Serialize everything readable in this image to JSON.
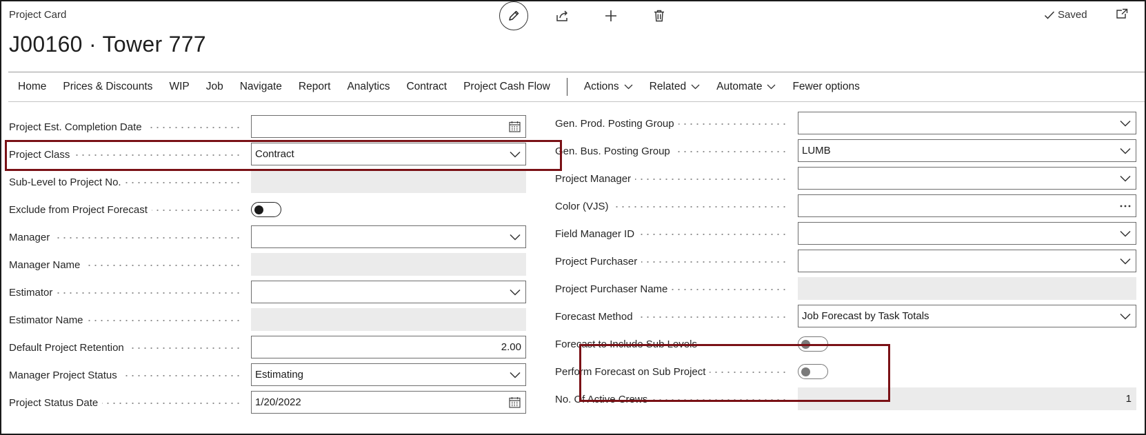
{
  "header": {
    "caption": "Project Card",
    "title": "J00160 · Tower 777",
    "saved_label": "Saved"
  },
  "toolbar": {
    "icons": [
      "edit-icon",
      "share-icon",
      "add-icon",
      "delete-icon",
      "popout-icon"
    ]
  },
  "menu": {
    "items": [
      "Home",
      "Prices & Discounts",
      "WIP",
      "Job",
      "Navigate",
      "Report",
      "Analytics",
      "Contract",
      "Project Cash Flow"
    ],
    "dropdowns": [
      "Actions",
      "Related",
      "Automate"
    ],
    "fewer_options": "Fewer options"
  },
  "left_fields": [
    {
      "label": "Project Est. Completion Date",
      "value": "",
      "type": "date"
    },
    {
      "label": "Project Class",
      "value": "Contract",
      "type": "select"
    },
    {
      "label": "Sub-Level to Project No.",
      "value": "",
      "type": "readonly"
    },
    {
      "label": "Exclude from Project Forecast",
      "value": "off",
      "type": "toggle"
    },
    {
      "label": "Manager",
      "value": "",
      "type": "select"
    },
    {
      "label": "Manager Name",
      "value": "",
      "type": "readonly"
    },
    {
      "label": "Estimator",
      "value": "",
      "type": "select"
    },
    {
      "label": "Estimator Name",
      "value": "",
      "type": "readonly"
    },
    {
      "label": "Default Project Retention",
      "value": "2.00",
      "type": "number"
    },
    {
      "label": "Manager Project Status",
      "value": "Estimating",
      "type": "select"
    },
    {
      "label": "Project Status Date",
      "value": "1/20/2022",
      "type": "date"
    }
  ],
  "right_fields": [
    {
      "label": "Gen. Prod. Posting Group",
      "value": "",
      "type": "select"
    },
    {
      "label": "Gen. Bus. Posting Group",
      "value": "LUMB",
      "type": "select"
    },
    {
      "label": "Project Manager",
      "value": "",
      "type": "select"
    },
    {
      "label": "Color (VJS)",
      "value": "",
      "type": "lookup"
    },
    {
      "label": "Field Manager ID",
      "value": "",
      "type": "select"
    },
    {
      "label": "Project Purchaser",
      "value": "",
      "type": "select"
    },
    {
      "label": "Project Purchaser Name",
      "value": "",
      "type": "readonly"
    },
    {
      "label": "Forecast Method",
      "value": "Job Forecast by Task Totals",
      "type": "select"
    },
    {
      "label": "Forecast to Include Sub Levels",
      "value": "off",
      "type": "toggle"
    },
    {
      "label": "Perform Forecast on Sub Project",
      "value": "off",
      "type": "toggle"
    },
    {
      "label": "No. Of Active Crews",
      "value": "1",
      "type": "readonly-number"
    }
  ],
  "colors": {
    "highlight": "#7a1116",
    "readonly_bg": "#ebebeb",
    "border": "#6d6d6d"
  }
}
